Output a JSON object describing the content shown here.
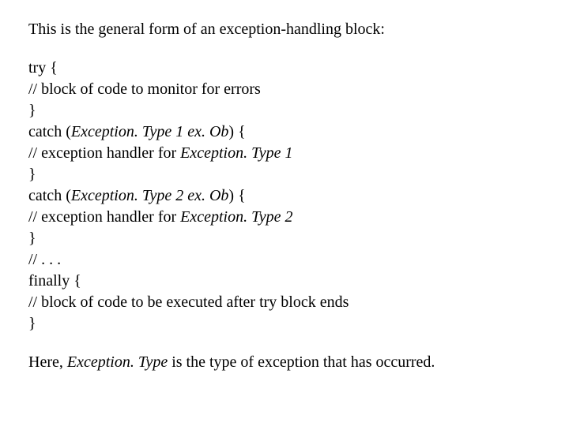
{
  "intro": "This is the general form of an exception-handling block:",
  "code": {
    "l1": "try {",
    "l2": "// block of code to monitor for errors",
    "l3": "}",
    "l4a": "catch (",
    "l4b": "Exception. Type 1 ex. Ob",
    "l4c": ") {",
    "l5a": "// exception handler for ",
    "l5b": "Exception. Type 1",
    "l6": "}",
    "l7a": "catch (",
    "l7b": "Exception. Type 2 ex. Ob",
    "l7c": ") {",
    "l8a": "// exception handler for ",
    "l8b": "Exception. Type 2",
    "l9": "}",
    "l10": "// . . .",
    "l11": "finally {",
    "l12": "// block of code to be executed after try block ends",
    "l13": "}"
  },
  "outro_a": "Here, ",
  "outro_b": "Exception. Type ",
  "outro_c": "is the type of exception that has occurred."
}
